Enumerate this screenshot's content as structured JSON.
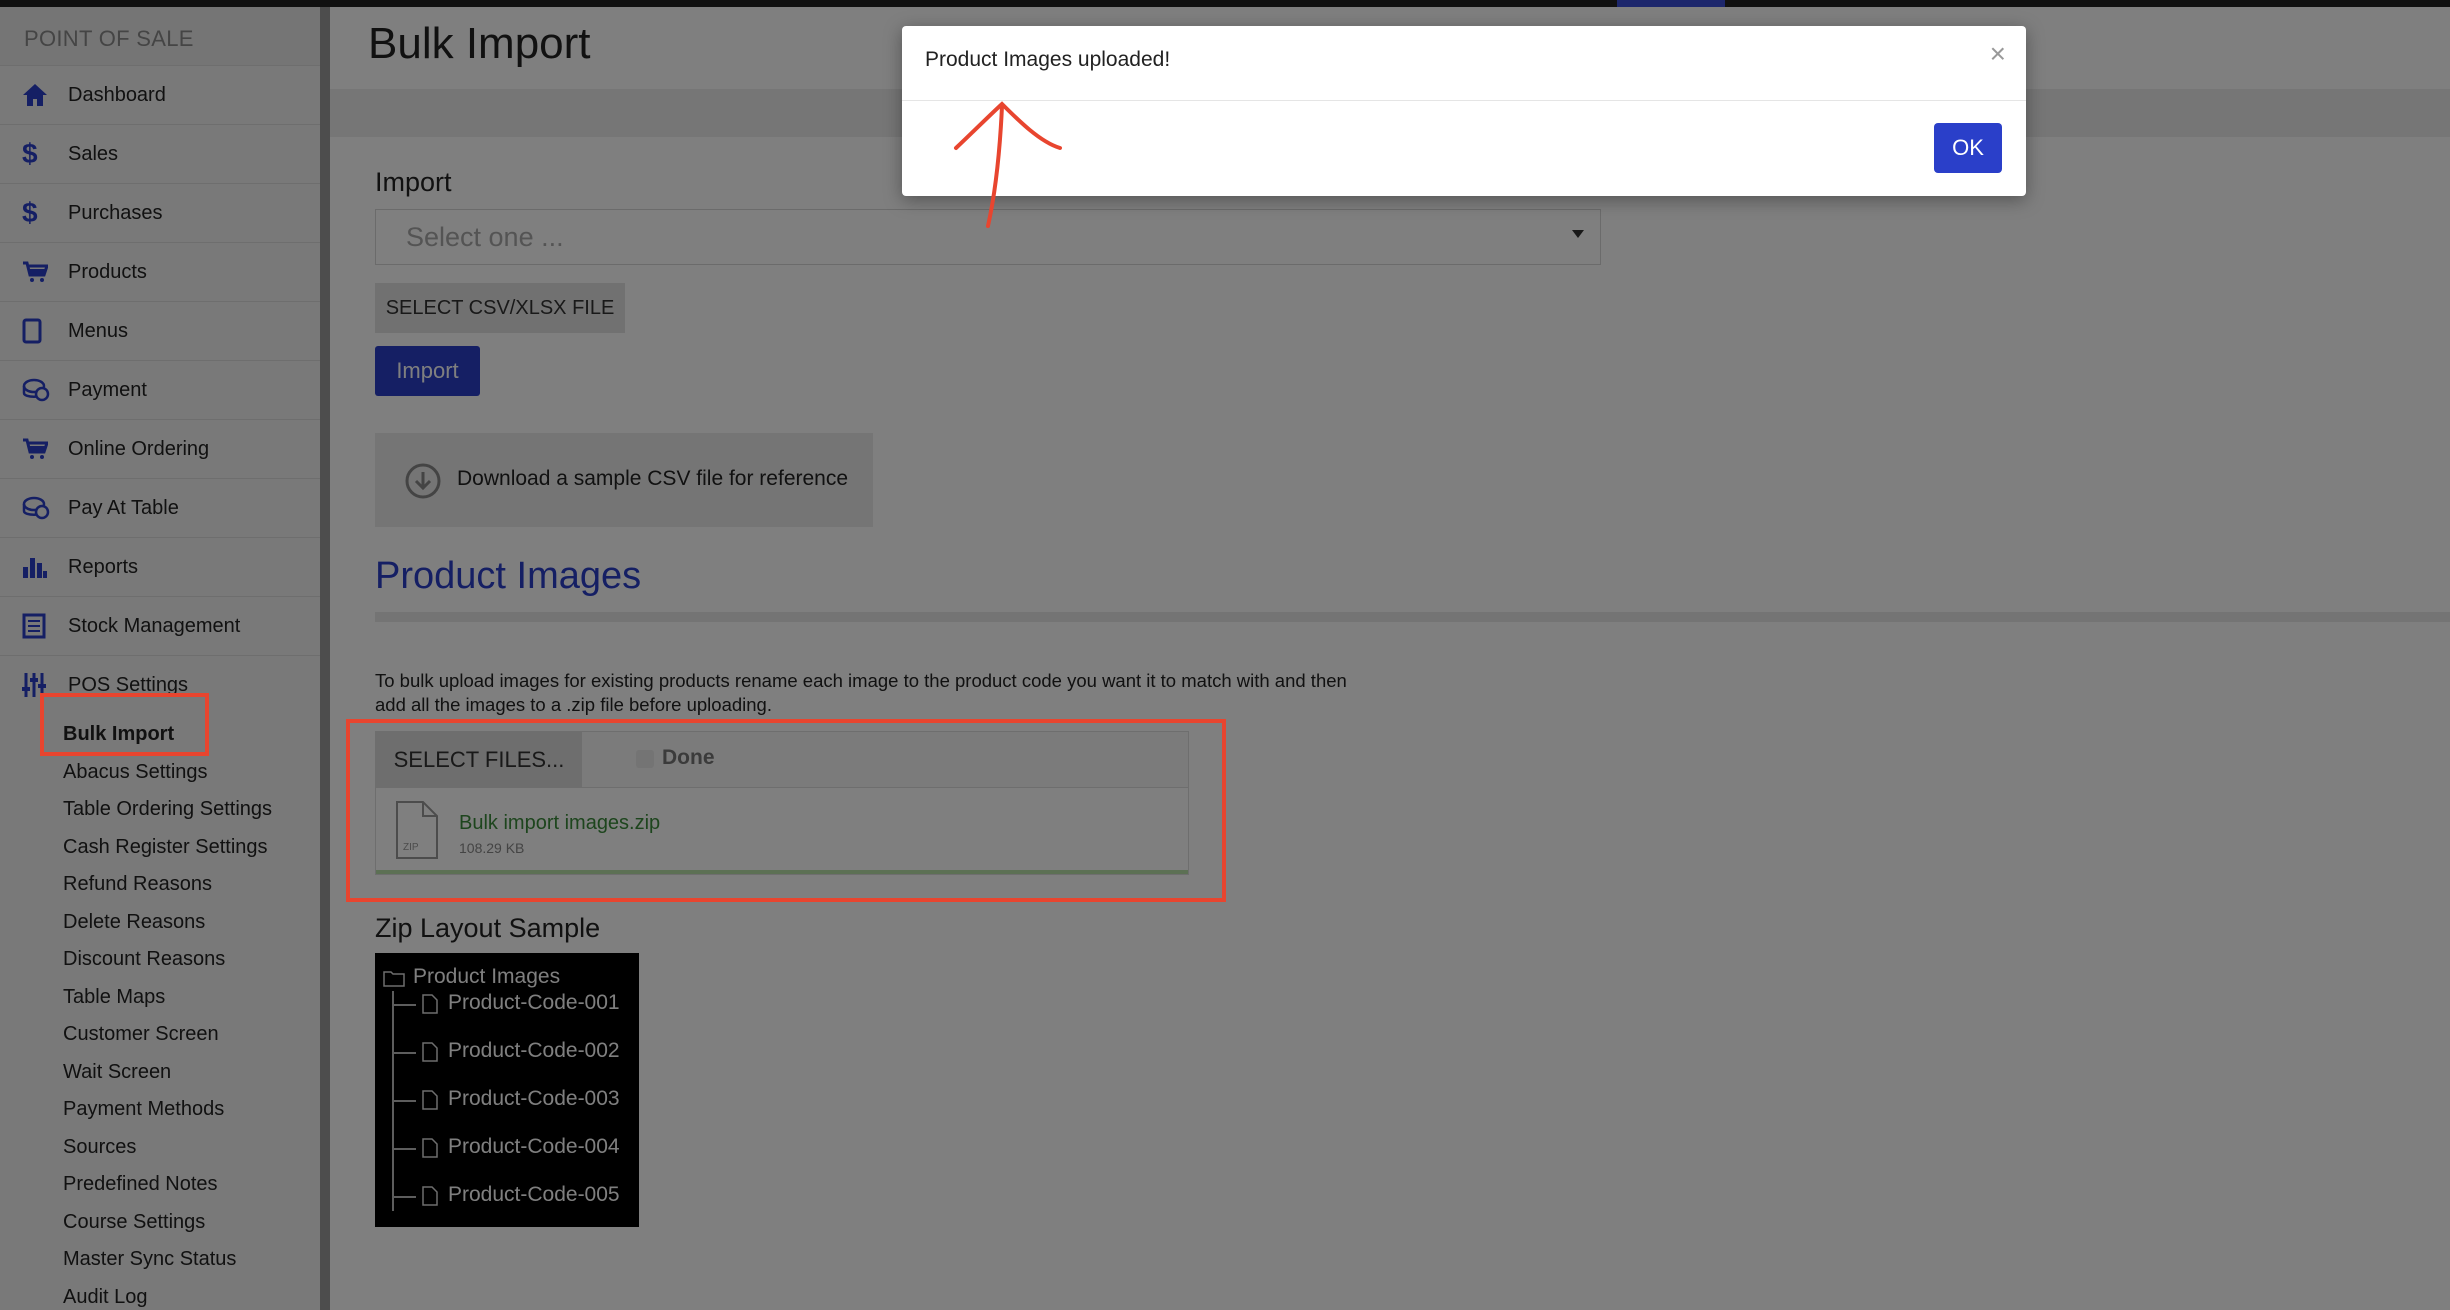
{
  "sidebar": {
    "title": "POINT OF SALE",
    "items": [
      {
        "label": "Dashboard",
        "icon": "home-icon"
      },
      {
        "label": "Sales",
        "icon": "dollar-icon"
      },
      {
        "label": "Purchases",
        "icon": "dollar-icon"
      },
      {
        "label": "Products",
        "icon": "cart-icon"
      },
      {
        "label": "Menus",
        "icon": "tablet-icon"
      },
      {
        "label": "Payment",
        "icon": "coins-icon"
      },
      {
        "label": "Online Ordering",
        "icon": "cart-icon"
      },
      {
        "label": "Pay At Table",
        "icon": "coins-icon"
      },
      {
        "label": "Reports",
        "icon": "bar-chart-icon"
      },
      {
        "label": "Stock Management",
        "icon": "ledger-icon"
      },
      {
        "label": "POS Settings",
        "icon": "sliders-icon"
      }
    ],
    "sub_items": [
      "Bulk Import",
      "Abacus Settings",
      "Table Ordering Settings",
      "Cash Register Settings",
      "Refund Reasons",
      "Delete Reasons",
      "Discount Reasons",
      "Table Maps",
      "Customer Screen",
      "Wait Screen",
      "Payment Methods",
      "Sources",
      "Predefined Notes",
      "Course Settings",
      "Master Sync Status",
      "Audit Log"
    ],
    "active_sub_item": "Bulk Import"
  },
  "main": {
    "title": "Bulk Import",
    "import_label": "Import",
    "select_placeholder": "Select one ...",
    "select_file_button": "SELECT CSV/XLSX FILE",
    "import_button": "Import",
    "sample_link": "Download a sample CSV file for reference",
    "product_images_title": "Product Images",
    "help_text": "To bulk upload images for existing products rename each image to the product code you want it to match with and then add all the images to a .zip file before uploading.",
    "upload": {
      "select_files_button": "SELECT FILES...",
      "status": "Done",
      "file_name": "Bulk import images.zip",
      "file_size": "108.29 KB",
      "file_badge": "ZIP"
    },
    "zip_layout_label": "Zip Layout Sample",
    "zip_layout": {
      "root": "Product Images",
      "files": [
        "Product-Code-001",
        "Product-Code-002",
        "Product-Code-003",
        "Product-Code-004",
        "Product-Code-005"
      ]
    }
  },
  "modal": {
    "message": "Product Images uploaded!",
    "close_symbol": "×",
    "ok_button": "OK"
  },
  "colors": {
    "accent": "#2a3fc9",
    "annotation": "#e8452f",
    "success": "#3a8a3a"
  }
}
